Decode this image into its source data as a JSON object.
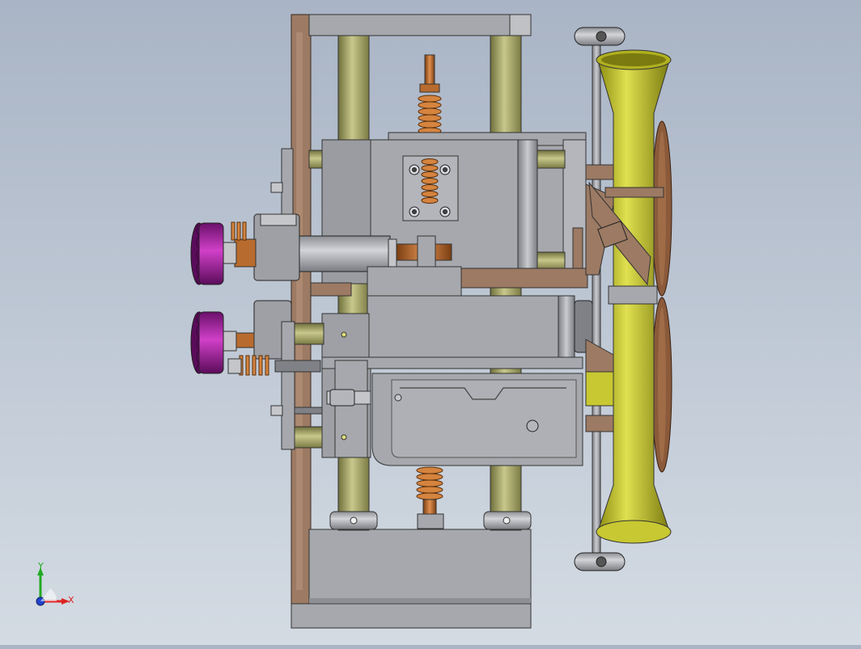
{
  "viewport": {
    "background_top": "#a9b4c5",
    "background_bottom": "#d4dbe3"
  },
  "colors": {
    "frame_brown": "#9c7a63",
    "steel_gray": "#a6a8ad",
    "dark_gray": "#7f8186",
    "rod_olive": "#a8a86a",
    "copper": "#b86b2e",
    "yellow_tube": "#c8c832",
    "bronze_wheel": "#8a5a3a",
    "magenta_knob": "#a8259c"
  },
  "triad": {
    "y_label": "Y",
    "x_label": "X",
    "y_color": "#22aa22",
    "x_color": "#dd2222",
    "z_color": "#2244cc"
  }
}
